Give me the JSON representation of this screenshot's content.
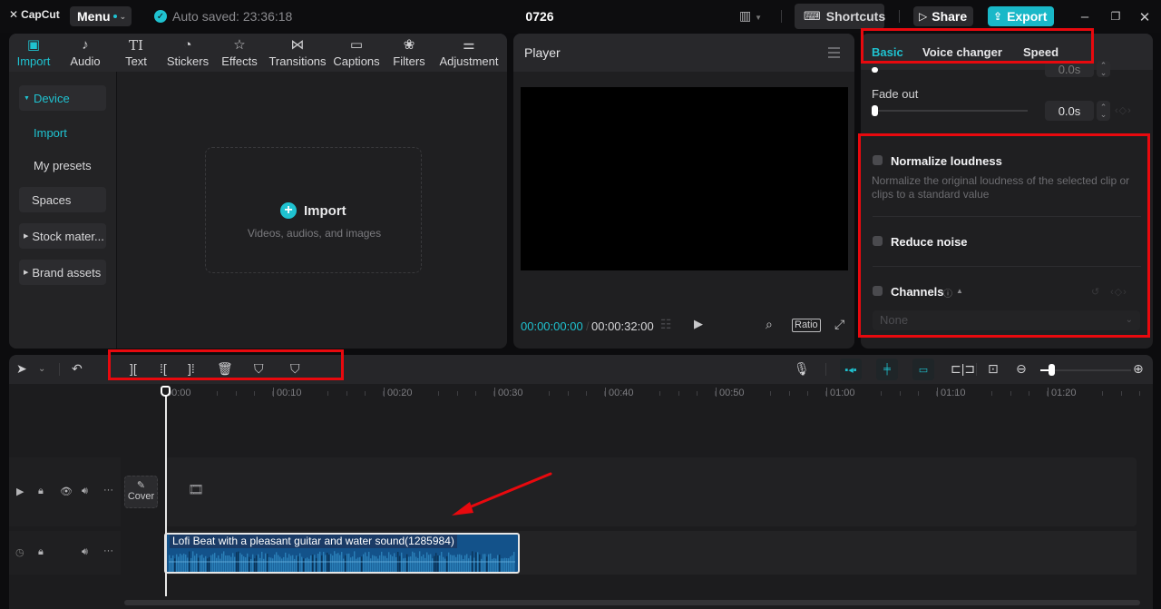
{
  "titlebar": {
    "app_name": "CapCut",
    "menu_label": "Menu",
    "auto_saved": "Auto saved: 23:36:18",
    "project_title": "0726",
    "shortcuts_label": "Shortcuts",
    "share_label": "Share",
    "export_label": "Export",
    "accent_color": "#1fc2d0"
  },
  "media": {
    "tabs": [
      {
        "label": "Import",
        "icon": "import-icon",
        "active": true
      },
      {
        "label": "Audio",
        "icon": "audio-icon"
      },
      {
        "label": "Text",
        "icon": "text-icon"
      },
      {
        "label": "Stickers",
        "icon": "stickers-icon"
      },
      {
        "label": "Effects",
        "icon": "effects-icon"
      },
      {
        "label": "Transitions",
        "icon": "transitions-icon"
      },
      {
        "label": "Captions",
        "icon": "captions-icon"
      },
      {
        "label": "Filters",
        "icon": "filters-icon"
      },
      {
        "label": "Adjustment",
        "icon": "adjustment-icon"
      }
    ],
    "sidebar": {
      "device": "Device",
      "import": "Import",
      "my_presets": "My presets",
      "spaces": "Spaces",
      "stock": "Stock mater...",
      "brand": "Brand assets"
    },
    "import_box": {
      "title": "Import",
      "subtitle": "Videos, audios, and images"
    }
  },
  "player": {
    "title": "Player",
    "current_time": "00:00:00:00",
    "total_time": "00:00:32:00",
    "ratio_label": "Ratio"
  },
  "props": {
    "tabs": [
      {
        "label": "Basic",
        "active": true
      },
      {
        "label": "Voice changer"
      },
      {
        "label": "Speed"
      }
    ],
    "fade_in_value": "0.0s",
    "fade_out_label": "Fade out",
    "fade_out_value": "0.0s",
    "normalize": {
      "title": "Normalize loudness",
      "desc": "Normalize the original loudness of the selected clip or clips to a standard value",
      "checked": false
    },
    "reduce_noise": {
      "title": "Reduce noise",
      "checked": false
    },
    "channels": {
      "title": "Channels",
      "checked": false,
      "value": "None"
    }
  },
  "timeline": {
    "ruler_labels": [
      "00:00",
      "00:10",
      "00:20",
      "00:30",
      "00:40",
      "00:50",
      "01:00",
      "01:10",
      "01:20"
    ],
    "cover_label": "Cover",
    "audio_clip": {
      "name": "Lofi Beat with a pleasant guitar and water sound(1285984)",
      "color": "#13528a"
    },
    "zoom_level": 0.12
  },
  "annotations": {
    "highlight_color": "#e8090e"
  }
}
